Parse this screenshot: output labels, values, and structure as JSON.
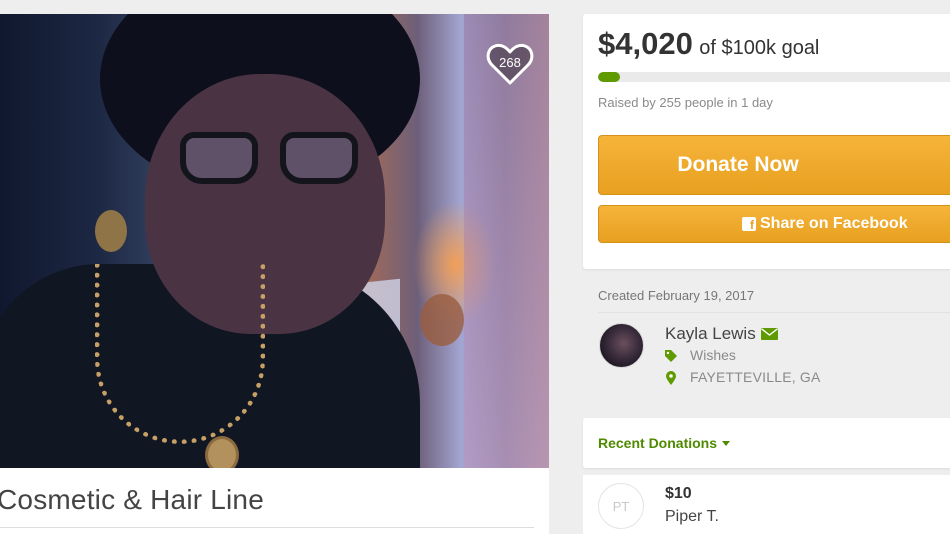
{
  "campaign": {
    "title": "Cosmetic & Hair Line",
    "heart_count": "268",
    "photo_icon": "campaign-photo"
  },
  "donate": {
    "amount_raised": "$4,020",
    "goal_text": "of $100k goal",
    "progress_fraction": 0.04,
    "raised_by": "Raised by 255 people in 1 day",
    "donate_label": "Donate Now",
    "share_label": "Share on Facebook",
    "share_icon": "facebook-icon",
    "accent_color": "#5f9a00",
    "button_color": "#f0a92c"
  },
  "organizer": {
    "created": "Created February 19, 2017",
    "name": "Kayla Lewis",
    "category": "Wishes",
    "location": "FAYETTEVILLE, GA",
    "contact_icon": "envelope-icon",
    "category_icon": "tag-icon",
    "location_icon": "map-pin-icon"
  },
  "recent_donations": {
    "label": "Recent Donations",
    "items": [
      {
        "initials": "PT",
        "amount": "$10",
        "name": "Piper T."
      }
    ]
  }
}
